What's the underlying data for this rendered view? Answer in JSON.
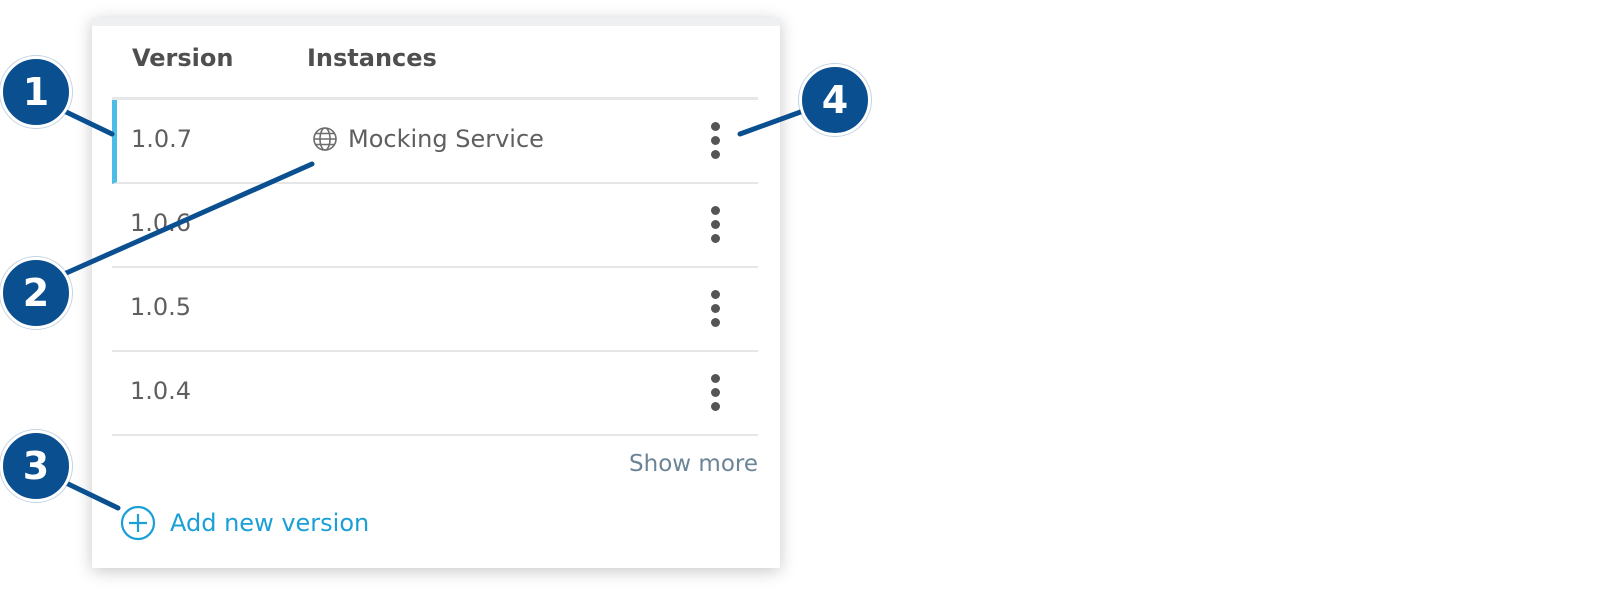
{
  "table": {
    "headers": {
      "version": "Version",
      "instances": "Instances"
    },
    "rows": [
      {
        "version": "1.0.7",
        "instance": "Mocking Service",
        "selected": true
      },
      {
        "version": "1.0.6",
        "instance": ""
      },
      {
        "version": "1.0.5",
        "instance": ""
      },
      {
        "version": "1.0.4",
        "instance": ""
      }
    ]
  },
  "show_more_label": "Show more",
  "add_version_label": "Add new version",
  "callouts": [
    "1",
    "2",
    "3",
    "4"
  ],
  "colors": {
    "callout": "#0a4f8f",
    "selected_accent": "#4bbde6",
    "link": "#1aa0d6"
  },
  "icons": {
    "instance": "globe-icon",
    "row_menu": "kebab-menu-icon",
    "add": "plus-circle-icon"
  }
}
